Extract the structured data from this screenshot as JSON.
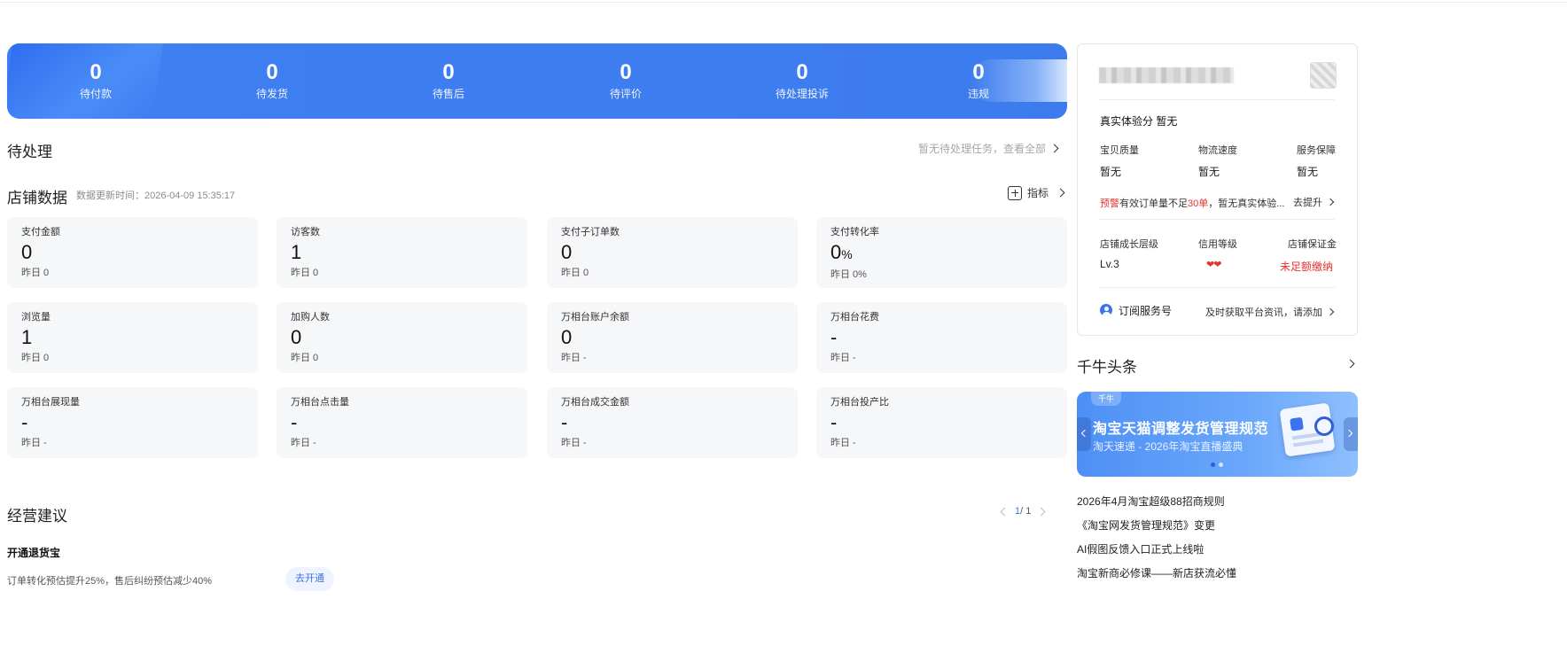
{
  "banner": {
    "stats": [
      {
        "value": "0",
        "label": "待付款"
      },
      {
        "value": "0",
        "label": "待发货"
      },
      {
        "value": "0",
        "label": "待售后"
      },
      {
        "value": "0",
        "label": "待评价"
      },
      {
        "value": "0",
        "label": "待处理投诉"
      },
      {
        "value": "0",
        "label": "违规"
      }
    ]
  },
  "pending": {
    "title": "待处理",
    "link": "暂无待处理任务，查看全部"
  },
  "shop_data": {
    "title": "店铺数据",
    "update_time": "数据更新时间：2026-04-09 15:35:17",
    "indicator_label": "指标",
    "cards": [
      {
        "title": "支付金额",
        "value": "0",
        "yesterday": "昨日 0"
      },
      {
        "title": "访客数",
        "value": "1",
        "yesterday": "昨日 0"
      },
      {
        "title": "支付子订单数",
        "value": "0",
        "yesterday": "昨日 0"
      },
      {
        "title": "支付转化率",
        "value": "0",
        "unit": "%",
        "yesterday": "昨日 0%"
      },
      {
        "title": "浏览量",
        "value": "1",
        "yesterday": "昨日 0"
      },
      {
        "title": "加购人数",
        "value": "0",
        "yesterday": "昨日 0"
      },
      {
        "title": "万相台账户余额",
        "value": "0",
        "yesterday": "昨日 -"
      },
      {
        "title": "万相台花费",
        "value": "-",
        "yesterday": "昨日 -"
      },
      {
        "title": "万相台展现量",
        "value": "-",
        "yesterday": "昨日 -"
      },
      {
        "title": "万相台点击量",
        "value": "-",
        "yesterday": "昨日 -"
      },
      {
        "title": "万相台成交金额",
        "value": "-",
        "yesterday": "昨日 -"
      },
      {
        "title": "万相台投产比",
        "value": "-",
        "yesterday": "昨日 -"
      }
    ]
  },
  "advice": {
    "title": "经营建议",
    "pager": {
      "current": "1",
      "total": "/ 1"
    },
    "item_title": "开通退货宝",
    "item_desc": "订单转化预估提升25%，售后纠纷预估减少40%",
    "button": "去开通"
  },
  "panel": {
    "experience_label": "真实体验分",
    "experience_value": "暂无",
    "metrics": [
      {
        "label": "宝贝质量",
        "value": "暂无"
      },
      {
        "label": "物流速度",
        "value": "暂无"
      },
      {
        "label": "服务保障",
        "value": "暂无"
      }
    ],
    "warning_tag": "预警",
    "warning_text_1": "有效订单量不足",
    "warning_count": "30单",
    "warning_text_2": "，暂无真实体验...",
    "improve_link": "去提升",
    "growth_label": "店铺成长层级",
    "growth_value": "Lv.3",
    "credit_label": "信用等级",
    "credit_value": "❤❤",
    "deposit_label": "店铺保证金",
    "deposit_value": "未足额缴纳",
    "subscribe_label": "订阅服务号",
    "subscribe_desc": "及时获取平台资讯，请添加"
  },
  "news": {
    "title": "千牛头条",
    "banner_brand": "千牛",
    "banner_headline": "淘宝天猫调整发货管理规范",
    "banner_sub": "淘天速递 - 2026年淘宝直播盛典",
    "items": [
      "2026年4月淘宝超级88招商规则",
      "《淘宝网发货管理规范》变更",
      "AI假图反馈入口正式上线啦",
      "淘宝新商必修课——新店获流必懂"
    ]
  },
  "colors": {
    "brand_blue": "#3d7ff1",
    "warning_red": "#e5322d",
    "card_bg": "#f6f7f9"
  }
}
